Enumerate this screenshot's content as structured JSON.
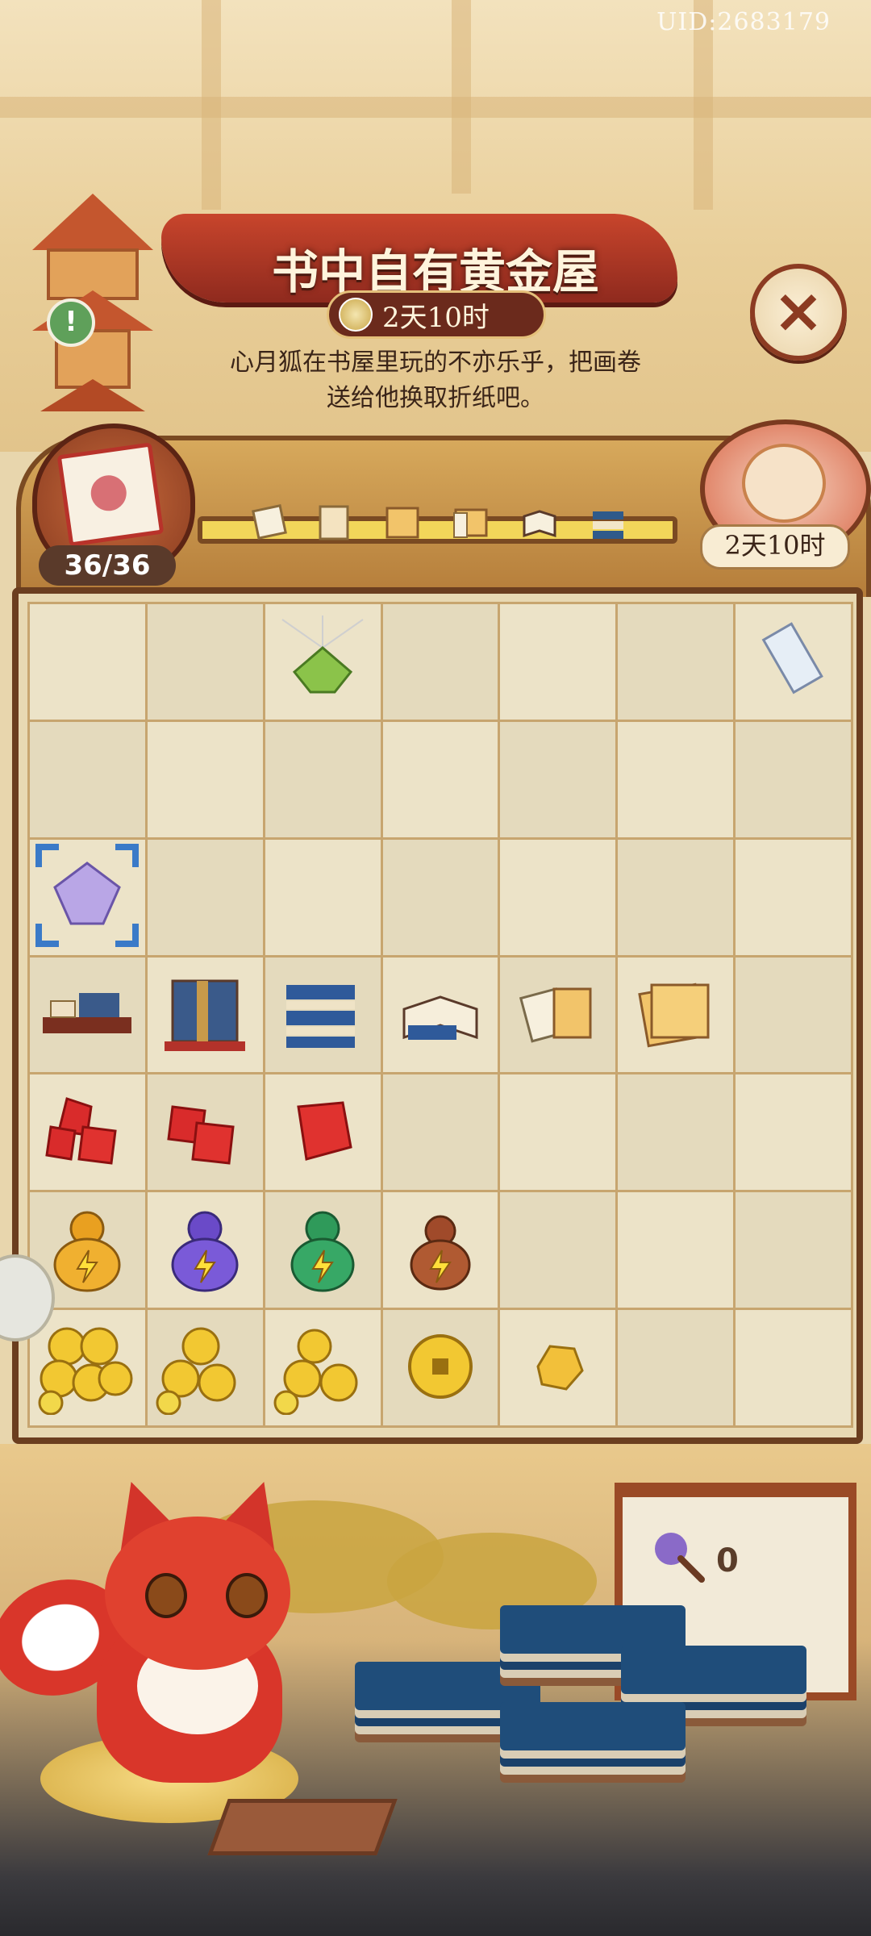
{
  "header": {
    "uid": "UID:2683179",
    "title": "书中自有黄金屋",
    "timer": "2天10时",
    "description_line1": "心月狐在书屋里玩的不亦乐乎，把画卷",
    "description_line2": "送给他换取折纸吧。"
  },
  "progress": {
    "counter": "36/36",
    "fraction": 1.0,
    "stages": [
      "scroll",
      "letter",
      "paper-bundle",
      "book",
      "folded-papers",
      "open-book",
      "book-stack"
    ]
  },
  "character": {
    "timer": "2天10时"
  },
  "grid": {
    "cols": 7,
    "rows": 7,
    "cells": [
      [
        "",
        "",
        "origami-frog-cobweb",
        "",
        "",
        "",
        "paper-scroll"
      ],
      [
        "",
        "",
        "",
        "",
        "",
        "",
        ""
      ],
      [
        "origami-fortune-teller-selected",
        "",
        "",
        "",
        "",
        "",
        ""
      ],
      [
        "scroll-table",
        "book-shelf-stand",
        "book-stack",
        "open-books",
        "folded-papers",
        "paper-bundle",
        ""
      ],
      [
        "red-gems-3",
        "red-gems-2",
        "red-gem-1",
        "",
        "",
        "",
        ""
      ],
      [
        "energy-gourd-orange",
        "energy-gourd-purple",
        "energy-gourd-green",
        "energy-gourd-brown",
        "",
        "",
        ""
      ],
      [
        "coin-pile-3",
        "coin-pile-2",
        "coin-pile-1",
        "copper-coin",
        "gold-nugget",
        "",
        ""
      ]
    ]
  },
  "bottom": {
    "duster_count": "0"
  },
  "colors": {
    "banner": "#c8452c",
    "board": "#e8d9b3",
    "border": "#6b3e1f",
    "accent_gold": "#f2d65a"
  }
}
